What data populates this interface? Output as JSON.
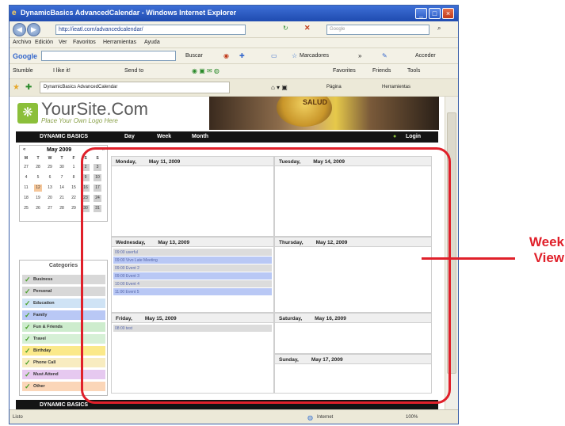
{
  "window": {
    "title": "DynamicBasics AdvancedCalendar - Windows Internet Explorer"
  },
  "addressbar": {
    "url": "http://ieatl.com/advancedcalendar/",
    "search_placeholder": "Google"
  },
  "menu": [
    "Archivo",
    "Edición",
    "Ver",
    "Favoritos",
    "Herramientas",
    "Ayuda"
  ],
  "googlebar": {
    "label": "Google",
    "buscar": "Buscar",
    "marcadores": "Marcadores",
    "acceder": "Acceder"
  },
  "linksbar": {
    "stumble": "Stumble",
    "ilike": "I like it!",
    "sendto": "Send to",
    "favorites": "Favorites",
    "friends": "Friends",
    "tools": "Tools"
  },
  "tab": {
    "label": "DynamicBasics AdvancedCalendar",
    "pagina": "Página",
    "herramientas": "Herramientas"
  },
  "site": {
    "logo_main": "YourSite.Com",
    "logo_sub": "Place Your Own Logo Here",
    "banner_text": "SALUD"
  },
  "topnav": {
    "brand": "DYNAMIC BASICS",
    "day": "Day",
    "week": "Week",
    "month": "Month",
    "login": "Login"
  },
  "minical": {
    "month": "May 2009",
    "prev": "«",
    "next": "»",
    "weekdays": [
      "M",
      "T",
      "W",
      "T",
      "F",
      "S",
      "S"
    ],
    "weeks": [
      [
        "27",
        "28",
        "29",
        "30",
        "1",
        "2",
        "3"
      ],
      [
        "4",
        "5",
        "6",
        "7",
        "8",
        "9",
        "10"
      ],
      [
        "11",
        "12",
        "13",
        "14",
        "15",
        "16",
        "17"
      ],
      [
        "18",
        "19",
        "20",
        "21",
        "22",
        "23",
        "24"
      ],
      [
        "25",
        "26",
        "27",
        "28",
        "29",
        "30",
        "31"
      ]
    ]
  },
  "categories": {
    "title": "Categories",
    "items": [
      {
        "label": "Business",
        "color": "#d8d8d8"
      },
      {
        "label": "Personal",
        "color": "#d8d8d8"
      },
      {
        "label": "Education",
        "color": "#cfe3f5"
      },
      {
        "label": "Family",
        "color": "#b9c8f5"
      },
      {
        "label": "Fun & Friends",
        "color": "#cdeccd"
      },
      {
        "label": "Travel",
        "color": "#d6f0d6"
      },
      {
        "label": "Birthday",
        "color": "#fbe98a"
      },
      {
        "label": "Phone Call",
        "color": "#f8ecc0"
      },
      {
        "label": "Must Attend",
        "color": "#e6c9f0"
      },
      {
        "label": "Other",
        "color": "#fbd6b8"
      }
    ]
  },
  "week": {
    "monday": {
      "name": "Monday,",
      "date": "May 11, 2009",
      "events": []
    },
    "tuesday": {
      "name": "Tuesday,",
      "date": "May 14, 2009",
      "events": []
    },
    "wednesday": {
      "name": "Wednesday,",
      "date": "May 13, 2009",
      "events": [
        "09:00 userful",
        "09:00 Vivo Late Meeting",
        "09:00 Event 2",
        "09:00 Event 3",
        "10:00 Event 4",
        "11:00 Event 5"
      ]
    },
    "thursday": {
      "name": "Thursday,",
      "date": "May 12, 2009",
      "events": []
    },
    "friday": {
      "name": "Friday,",
      "date": "May 15, 2009",
      "events": [
        "08:00 test"
      ]
    },
    "saturday": {
      "name": "Saturday,",
      "date": "May 16, 2009",
      "events": []
    },
    "sunday": {
      "name": "Sunday,",
      "date": "May 17, 2009",
      "events": []
    }
  },
  "bottomnav": {
    "brand": "DYNAMIC BASICS"
  },
  "statusbar": {
    "left": "Listo",
    "zone": "Internet",
    "zoom": "100%"
  },
  "annotation": {
    "line1": "Week",
    "line2": "View"
  },
  "colors": {
    "accent": "#e0202a",
    "ev_blue": "#b9c8f5",
    "ev_gray": "#dcdcdc"
  }
}
